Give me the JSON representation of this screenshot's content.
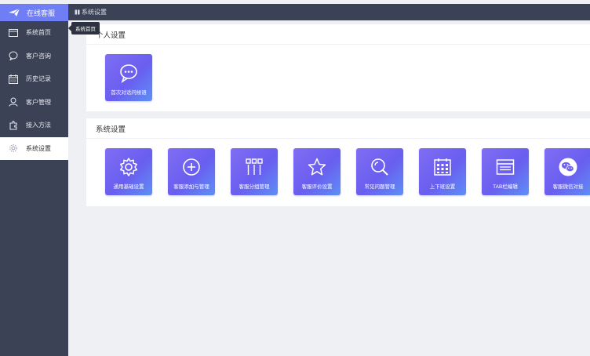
{
  "sidebar": {
    "brand_label": "在线客服",
    "items": [
      {
        "label": "系统首页",
        "icon": "browser-window-icon"
      },
      {
        "label": "客户咨询",
        "icon": "chat-bubble-icon"
      },
      {
        "label": "历史记录",
        "icon": "calendar-icon"
      },
      {
        "label": "客户管理",
        "icon": "user-icon"
      },
      {
        "label": "接入方法",
        "icon": "puzzle-icon"
      },
      {
        "label": "系统设置",
        "icon": "gear-icon"
      }
    ],
    "tooltip": "系统首页"
  },
  "header": {
    "title": "系统设置"
  },
  "personal": {
    "title": "个人设置",
    "tiles": [
      {
        "label": "首次对话问候语",
        "icon": "chat-bubble-icon"
      }
    ]
  },
  "system": {
    "title": "系统设置",
    "tiles": [
      {
        "label": "通用基础设置",
        "icon": "gear-icon"
      },
      {
        "label": "客服添加与管理",
        "icon": "plus-circle-icon"
      },
      {
        "label": "客服分组管理",
        "icon": "grid-columns-icon"
      },
      {
        "label": "客服评价设置",
        "icon": "star-icon"
      },
      {
        "label": "常见问题管理",
        "icon": "search-icon"
      },
      {
        "label": "上下班设置",
        "icon": "calendar-icon"
      },
      {
        "label": "TAB栏编辑",
        "icon": "browser-window-icon"
      },
      {
        "label": "客服微信对接",
        "icon": "wechat-icon"
      }
    ]
  },
  "colors": {
    "sidebar": "#3b4256",
    "brand": "#6f7ef5",
    "tile_start": "#7f6ef3",
    "tile_end": "#5d8ff5"
  }
}
